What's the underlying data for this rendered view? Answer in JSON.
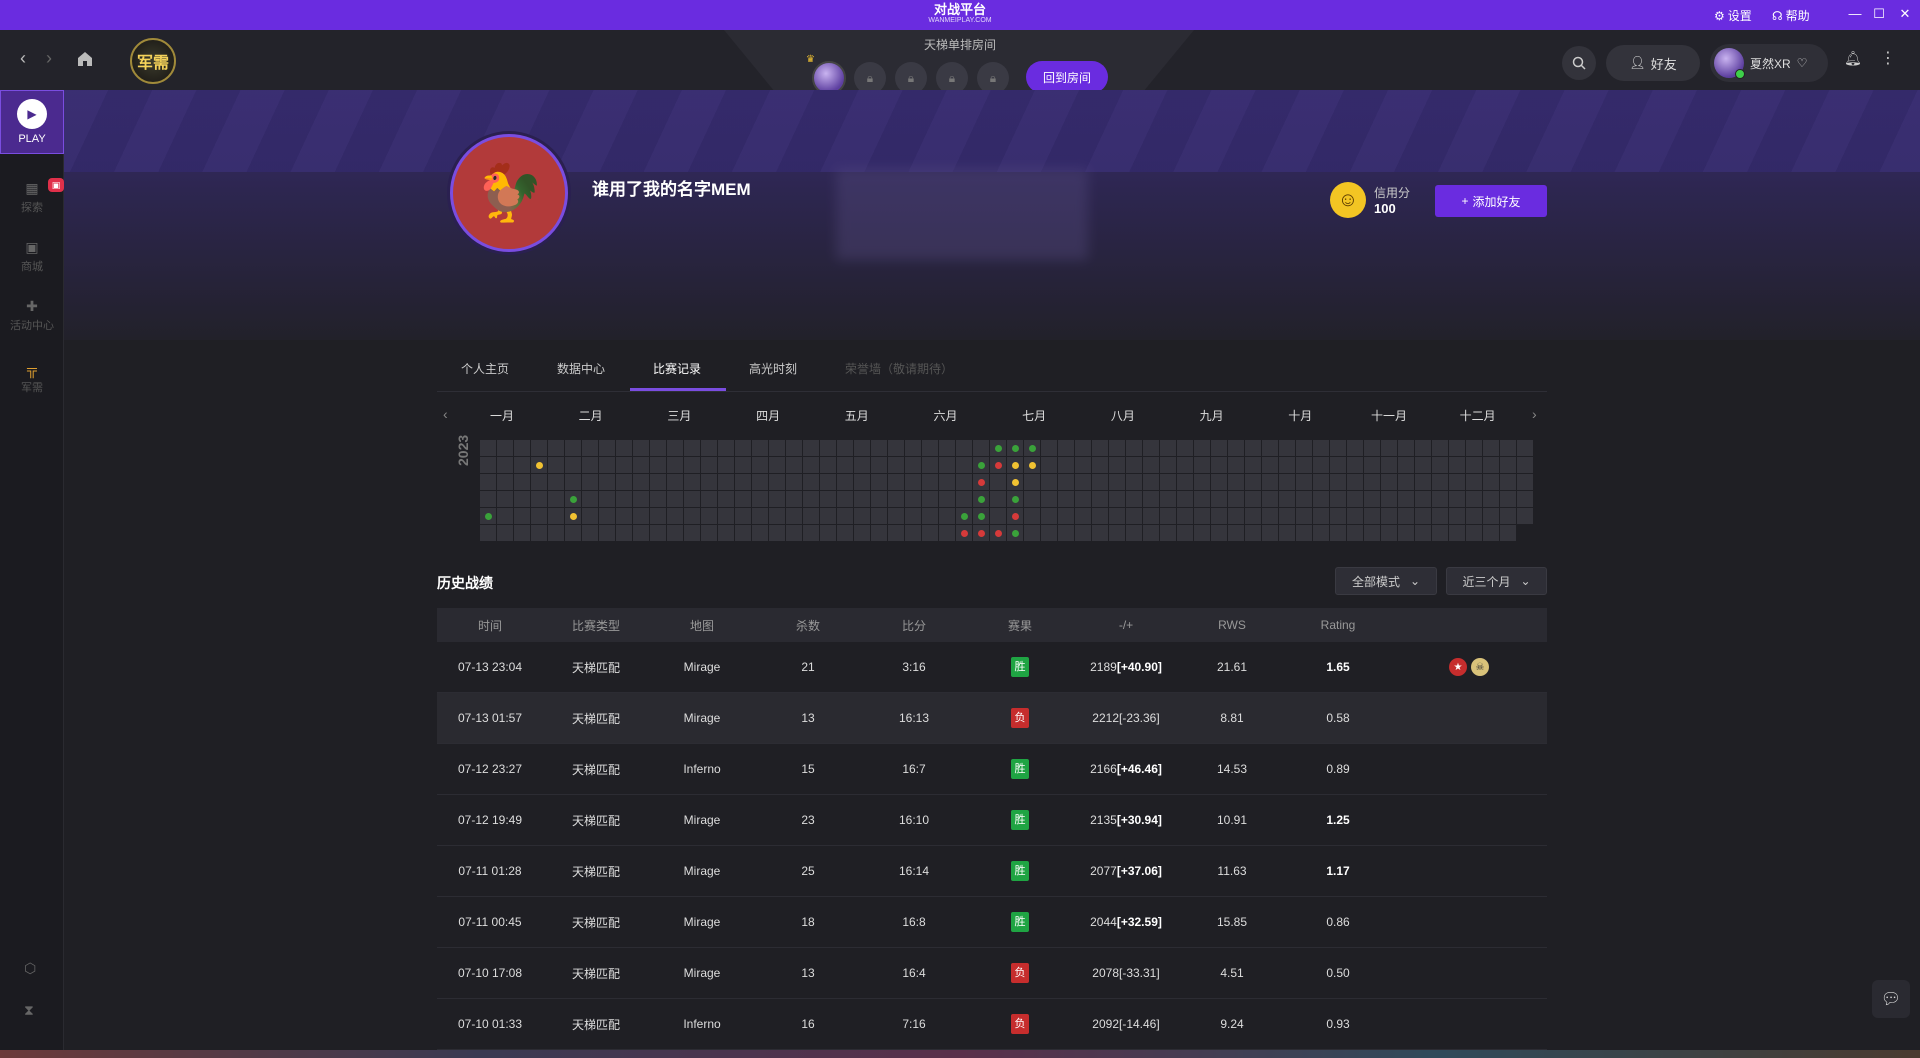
{
  "titlebar": {
    "logo": "对战平台",
    "logo_sub": "WANMEIPLAY.COM",
    "settings": "设置",
    "help": "帮助",
    "minimize": "—",
    "maximize": "☐",
    "close": "✕"
  },
  "nav": {
    "back_icon": "chevron-left-icon",
    "forward_icon": "chevron-right-icon",
    "badge_label": "军需"
  },
  "room": {
    "title": "天梯单排房间",
    "return_label": "回到房间",
    "locked_slots": 4
  },
  "header_right": {
    "friends_label": "好友",
    "username": "夏然XR"
  },
  "sidebar": {
    "play_label": "PLAY",
    "items": [
      {
        "label": "探索",
        "icon": "apps-icon",
        "badge": "🎁"
      },
      {
        "label": "商城",
        "icon": "bag-icon"
      },
      {
        "label": "活动中心",
        "icon": "gift-icon"
      },
      {
        "label": "军需",
        "icon": "gun-icon"
      }
    ]
  },
  "profile": {
    "name": "谁用了我的名字MEM",
    "credit_label": "信用分",
    "credit_value": "100",
    "add_friend_label": "添加好友"
  },
  "tabs": [
    {
      "label": "个人主页",
      "state": "normal"
    },
    {
      "label": "数据中心",
      "state": "normal"
    },
    {
      "label": "比赛记录",
      "state": "active"
    },
    {
      "label": "高光时刻",
      "state": "normal"
    },
    {
      "label": "荣誉墙（敬请期待）",
      "state": "disabled"
    }
  ],
  "calendar": {
    "year": "2023",
    "months": [
      "一月",
      "二月",
      "三月",
      "四月",
      "五月",
      "六月",
      "七月",
      "八月",
      "九月",
      "十月",
      "十一月",
      "十二月"
    ],
    "colors": {
      "win": "#3aa23a",
      "loss": "#d63a3a",
      "mixed": "#f1c232"
    },
    "matches": [
      {
        "week": 0,
        "day": 4,
        "result": "win"
      },
      {
        "week": 3,
        "day": 1,
        "result": "mixed"
      },
      {
        "week": 5,
        "day": 3,
        "result": "win"
      },
      {
        "week": 5,
        "day": 4,
        "result": "mixed"
      },
      {
        "week": 28,
        "day": 4,
        "result": "win"
      },
      {
        "week": 28,
        "day": 5,
        "result": "loss"
      },
      {
        "week": 29,
        "day": 1,
        "result": "win"
      },
      {
        "week": 29,
        "day": 2,
        "result": "loss"
      },
      {
        "week": 29,
        "day": 3,
        "result": "win"
      },
      {
        "week": 29,
        "day": 4,
        "result": "win"
      },
      {
        "week": 29,
        "day": 5,
        "result": "loss"
      },
      {
        "week": 30,
        "day": 0,
        "result": "win"
      },
      {
        "week": 30,
        "day": 1,
        "result": "loss"
      },
      {
        "week": 30,
        "day": 5,
        "result": "loss"
      },
      {
        "week": 31,
        "day": 0,
        "result": "win"
      },
      {
        "week": 31,
        "day": 1,
        "result": "mixed"
      },
      {
        "week": 31,
        "day": 2,
        "result": "mixed"
      },
      {
        "week": 31,
        "day": 3,
        "result": "win"
      },
      {
        "week": 31,
        "day": 4,
        "result": "loss"
      },
      {
        "week": 31,
        "day": 5,
        "result": "win"
      },
      {
        "week": 32,
        "day": 0,
        "result": "win"
      },
      {
        "week": 32,
        "day": 1,
        "result": "mixed"
      }
    ]
  },
  "history": {
    "title": "历史战绩",
    "mode_filter": "全部模式",
    "range_filter": "近三个月",
    "columns": [
      "时间",
      "比赛类型",
      "地图",
      "杀数",
      "比分",
      "赛果",
      "-/+",
      "RWS",
      "Rating"
    ],
    "win_label": "胜",
    "lose_label": "负",
    "rows": [
      {
        "time": "07-13 23:04",
        "type": "天梯匹配",
        "map": "Mirage",
        "kills": "21",
        "score": "3:16",
        "result": "win",
        "elo": "2189",
        "delta": "[+40.90]",
        "rws": "21.61",
        "rating": "1.65",
        "medals": true
      },
      {
        "time": "07-13 01:57",
        "type": "天梯匹配",
        "map": "Mirage",
        "kills": "13",
        "score": "16:13",
        "result": "lose",
        "elo": "2212",
        "delta": "[-23.36]",
        "rws": "8.81",
        "rating": "0.58",
        "medals": false
      },
      {
        "time": "07-12 23:27",
        "type": "天梯匹配",
        "map": "Inferno",
        "kills": "15",
        "score": "16:7",
        "result": "win",
        "elo": "2166",
        "delta": "[+46.46]",
        "rws": "14.53",
        "rating": "0.89",
        "medals": false
      },
      {
        "time": "07-12 19:49",
        "type": "天梯匹配",
        "map": "Mirage",
        "kills": "23",
        "score": "16:10",
        "result": "win",
        "elo": "2135",
        "delta": "[+30.94]",
        "rws": "10.91",
        "rating": "1.25",
        "medals": false
      },
      {
        "time": "07-11 01:28",
        "type": "天梯匹配",
        "map": "Mirage",
        "kills": "25",
        "score": "16:14",
        "result": "win",
        "elo": "2077",
        "delta": "[+37.06]",
        "rws": "11.63",
        "rating": "1.17",
        "medals": false
      },
      {
        "time": "07-11 00:45",
        "type": "天梯匹配",
        "map": "Mirage",
        "kills": "18",
        "score": "16:8",
        "result": "win",
        "elo": "2044",
        "delta": "[+32.59]",
        "rws": "15.85",
        "rating": "0.86",
        "medals": false
      },
      {
        "time": "07-10 17:08",
        "type": "天梯匹配",
        "map": "Mirage",
        "kills": "13",
        "score": "16:4",
        "result": "lose",
        "elo": "2078",
        "delta": "[-33.31]",
        "rws": "4.51",
        "rating": "0.50",
        "medals": false
      },
      {
        "time": "07-10 01:33",
        "type": "天梯匹配",
        "map": "Inferno",
        "kills": "16",
        "score": "7:16",
        "result": "lose",
        "elo": "2092",
        "delta": "[-14.46]",
        "rws": "9.24",
        "rating": "0.93",
        "medals": false
      }
    ]
  }
}
